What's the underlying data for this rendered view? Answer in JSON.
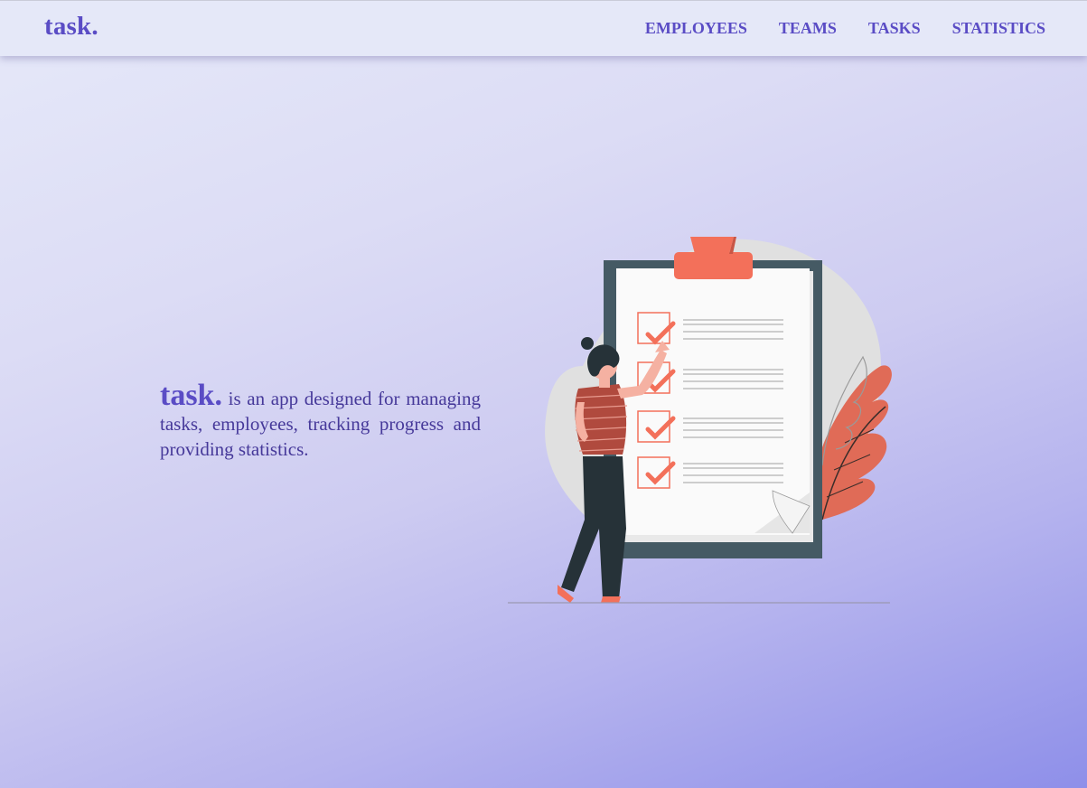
{
  "nav": {
    "logo": "task.",
    "links": [
      "EMPLOYEES",
      "TEAMS",
      "TASKS",
      "STATISTICS"
    ]
  },
  "hero": {
    "brand": "task.",
    "description": " is an app designed for managing tasks, employees, tracking progress and providing statistics."
  },
  "illustration": {
    "subject": "person checking off a clipboard checklist",
    "checked_items": 4
  },
  "colors": {
    "brand": "#5a4cc5",
    "accent": "#f3705a",
    "text": "#46399a",
    "navbar_bg": "#e5e8f8"
  }
}
